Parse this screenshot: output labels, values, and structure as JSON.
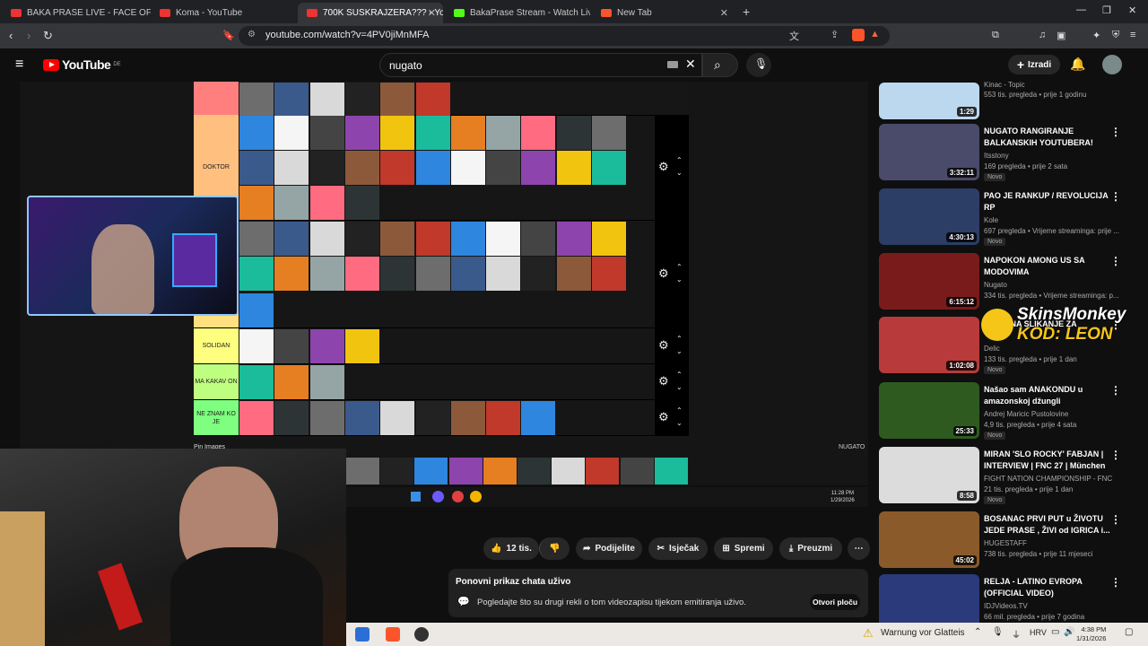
{
  "browser": {
    "tabs": [
      {
        "label": "BAKA PRASE LIVE - FACE OFF PRE",
        "fav": "#e33"
      },
      {
        "label": "Koma - YouTube",
        "fav": "#e33"
      },
      {
        "label": "700K SUSKRAJZERA??? - YouTub",
        "fav": "#e33",
        "active": true
      },
      {
        "label": "BakaPrase Stream - Watch Live on Ki",
        "fav": "#53fc18"
      },
      {
        "label": "New Tab",
        "fav": "#fb542b"
      }
    ],
    "url": "youtube.com/watch?v=4PV0jiMnMFA"
  },
  "youtube": {
    "logo": "YouTube",
    "region": "DE",
    "search_value": "nugato",
    "create_label": "Izradi"
  },
  "video": {
    "tiers": [
      {
        "label": "",
        "color": "#ff7f7f"
      },
      {
        "label": "DOKTOR",
        "color": "#ffbf7f"
      },
      {
        "label": "",
        "color": "#ffdf7f"
      },
      {
        "label": "SOLIDAN",
        "color": "#ffff7f"
      },
      {
        "label": "MA KAKAV ON",
        "color": "#bfff7f"
      },
      {
        "label": "NE ZNAM KO JE",
        "color": "#7fff7f"
      }
    ],
    "pin_label": "Pin Images",
    "watermark": "NUGATO",
    "clock_time": "11:28 PM",
    "clock_date": "1/29/2026"
  },
  "actions": {
    "likes": "12 tis.",
    "share": "Podijelite",
    "clip": "Isječak",
    "save": "Spremi",
    "download": "Preuzmi"
  },
  "chat_replay": {
    "title": "Ponovni prikaz chata uživo",
    "text": "Pogledajte što su drugi rekli o tom videozapisu tijekom emitiranja uživo.",
    "button": "Otvori ploču"
  },
  "recommendations": [
    {
      "title": "Kinac - Topic",
      "channel": "",
      "views": "553 tis. pregleda • prije 1 godinu",
      "duration": "1:29",
      "new": "",
      "color": "#bcd8ee"
    },
    {
      "title": "NUGATO RANGIRANJE BALKANSKIH YOUTUBERA!",
      "channel": "Itsstony",
      "views": "169 pregleda • prije 2 sata",
      "duration": "3:32:11",
      "new": "Novo",
      "color": "#4a4a6a"
    },
    {
      "title": "PAO JE RANKUP / REVOLUCIJA RP",
      "channel": "Kole",
      "views": "697 pregleda • Vrijeme streaminga: prije ...",
      "duration": "4:30:13",
      "new": "Novo",
      "color": "#2c3e66"
    },
    {
      "title": "NAPOKON AMONG US SA MODOVIMA",
      "channel": "Nugato",
      "views": "334 tis. pregleda • Vrijeme streaminga: p...",
      "duration": "6:15:12",
      "new": "",
      "color": "#7a1b1b"
    },
    {
      "title": "DELIC NA SLIKANJE ZA",
      "channel": "Delic",
      "views": "133 tis. pregleda • prije 1 dan",
      "duration": "1:02:08",
      "new": "Novo",
      "color": "#b83a3a"
    },
    {
      "title": "Našao sam ANAKONDU u amazonskoj džungli",
      "channel": "Andrej Maricic Pustolovine",
      "views": "4,9 tis. pregleda • prije 4 sata",
      "duration": "25:33",
      "new": "Novo",
      "color": "#2f5a1f"
    },
    {
      "title": "MIRAN 'SLO ROCKY' FABJAN | INTERVIEW | FNC 27 | München",
      "channel": "FIGHT NATION CHAMPIONSHIP - FNC",
      "views": "21 tis. pregleda • prije 1 dan",
      "duration": "8:58",
      "new": "Novo",
      "color": "#dcdcdc"
    },
    {
      "title": "BOSANAC PRVI PUT u ŽIVOTU JEDE PRASE , ŽIVI od IGRICA i...",
      "channel": "HUGESTAFF",
      "views": "738 tis. pregleda • prije 11 mjeseci",
      "duration": "45:02",
      "new": "",
      "color": "#8a5a2a"
    },
    {
      "title": "RELJA - LATINO EVROPA (OFFICIAL VIDEO)",
      "channel": "IDJVideos.TV",
      "views": "66 mil. pregleda • prije 7 godina",
      "duration": "",
      "new": "",
      "color": "#2a3a7a"
    }
  ],
  "ad": {
    "line1": "SkinsMonkey",
    "line2": "KOD: LEON"
  },
  "taskbar": {
    "warning": "Warnung vor Glatteis",
    "lang": "HRV",
    "time": "4:38 PM",
    "date": "1/31/2026"
  }
}
